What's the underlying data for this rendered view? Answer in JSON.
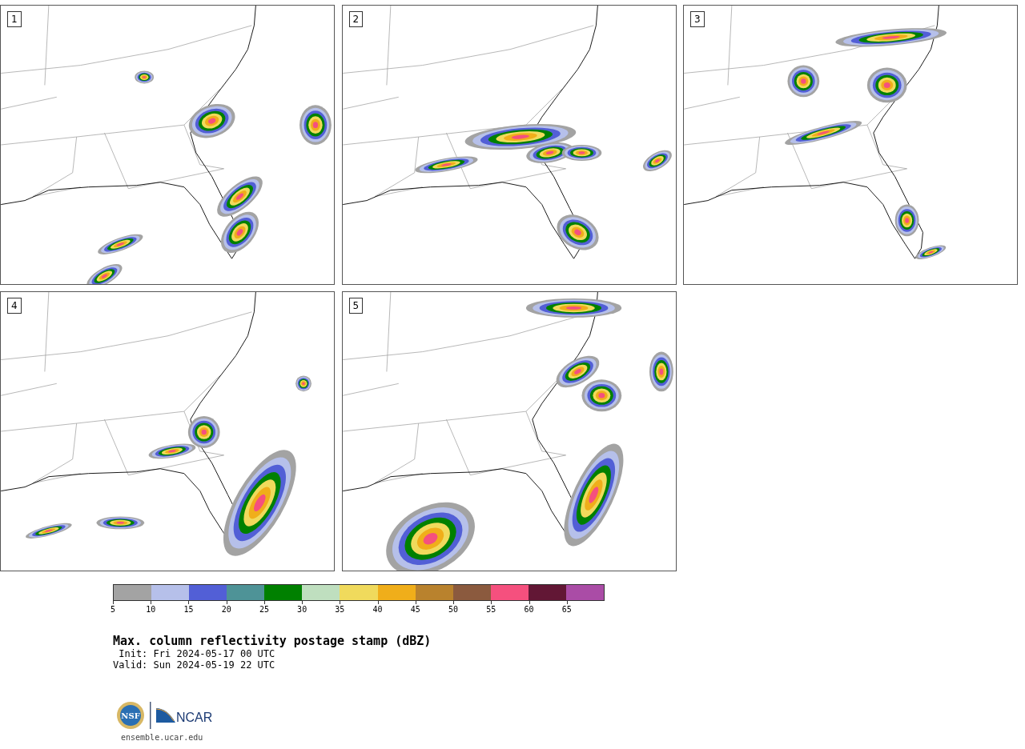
{
  "panels": [
    {
      "label": "1"
    },
    {
      "label": "2"
    },
    {
      "label": "3"
    },
    {
      "label": "4"
    },
    {
      "label": "5"
    }
  ],
  "colorbar": {
    "segments": [
      {
        "color": "#a3a3a3"
      },
      {
        "color": "#b6c0ea"
      },
      {
        "color": "#525fd6"
      },
      {
        "color": "#4e9397"
      },
      {
        "color": "#008000"
      },
      {
        "color": "#bfdfbf"
      },
      {
        "color": "#f0da5c"
      },
      {
        "color": "#f0ae1a"
      },
      {
        "color": "#b9822d"
      },
      {
        "color": "#8b5a3e"
      },
      {
        "color": "#f5507e"
      },
      {
        "color": "#621735"
      },
      {
        "color": "#aa4ca6"
      }
    ],
    "ticks": [
      "5",
      "10",
      "15",
      "20",
      "25",
      "30",
      "35",
      "40",
      "45",
      "50",
      "55",
      "60",
      "65"
    ]
  },
  "title": "Max. column reflectivity postage stamp (dBZ)",
  "init": " Init: Fri 2024-05-17 00 UTC",
  "valid": "Valid: Sun 2024-05-19 22 UTC",
  "logos": {
    "nsf": "NSF",
    "ncar": "NCAR"
  },
  "footer": "ensemble.ucar.edu"
}
